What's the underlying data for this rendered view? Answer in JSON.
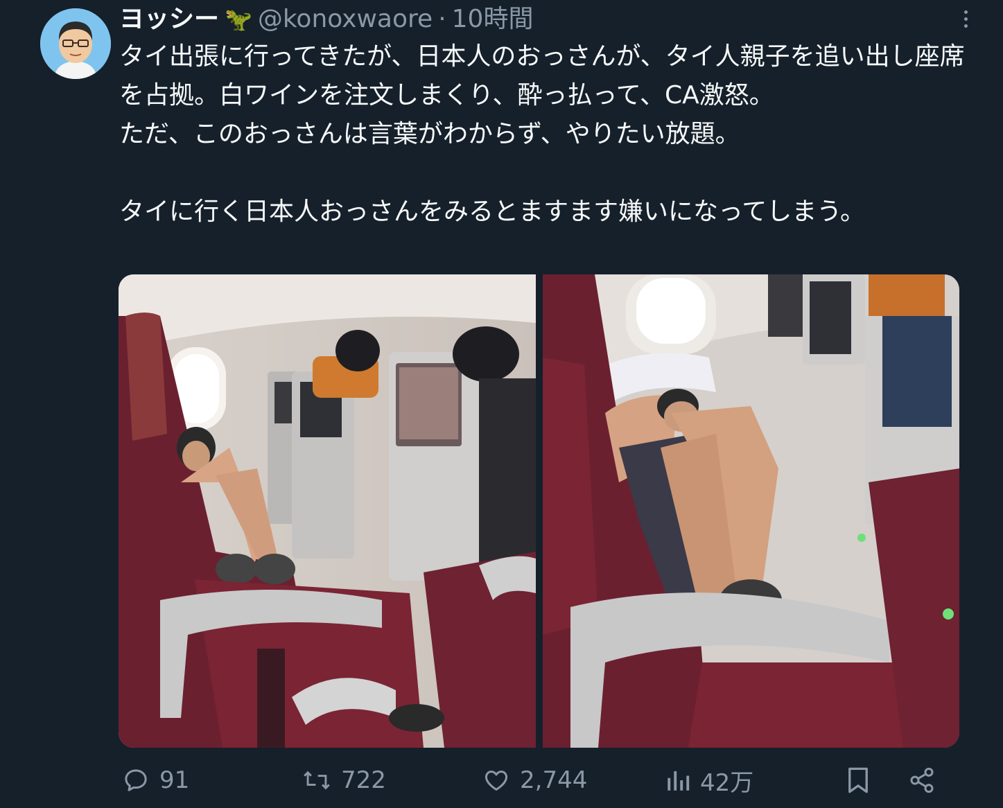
{
  "author": {
    "name": "ヨッシー",
    "emoji": "🦖",
    "handle": "@konoxwaore",
    "separator": "·",
    "time": "10時間"
  },
  "tweet": {
    "lines": [
      "タイ出張に行ってきたが、日本人のおっさんが、タイ人親子を追い出し座席を占拠。白ワインを注文しまくり、酔っ払って、CA激怒。",
      "ただ、このおっさんは言葉がわからず、やりたい放題。",
      "",
      "タイに行く日本人おっさんをみるとますます嫌いになってしまう。"
    ]
  },
  "media": {
    "count": 2,
    "photos": [
      {
        "subject": "airplane-cabin-man-feet-on-seat"
      },
      {
        "subject": "airplane-cabin-man-legs-up-closeup"
      }
    ]
  },
  "stats": {
    "replies": "91",
    "retweets": "722",
    "likes": "2,744",
    "views": "42万"
  },
  "icons": {
    "reply": "speech-bubble-icon",
    "retweet": "retweet-arrows-icon",
    "like": "heart-icon",
    "views": "bar-chart-icon",
    "bookmark": "bookmark-icon",
    "share": "share-nodes-icon",
    "more": "more-dots-icon"
  },
  "colors": {
    "background": "#15202b",
    "text": "#f7f9f9",
    "secondary": "#8b98a5",
    "seat": "#6b2030"
  }
}
